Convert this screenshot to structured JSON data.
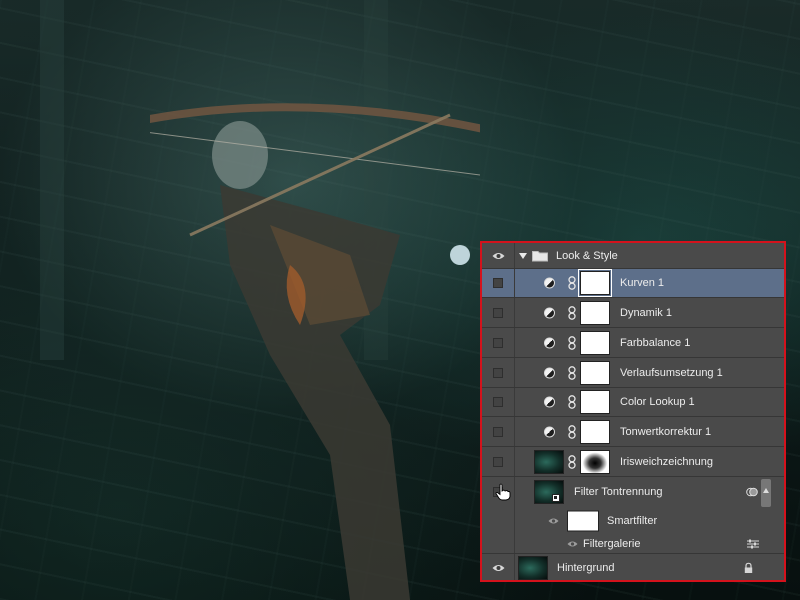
{
  "layers_panel": {
    "group": {
      "name": "Look & Style",
      "expanded": true,
      "visible": true
    },
    "layers": [
      {
        "name": "Kurven 1",
        "visible": false,
        "selected": true
      },
      {
        "name": "Dynamik 1",
        "visible": false,
        "selected": false
      },
      {
        "name": "Farbbalance 1",
        "visible": false,
        "selected": false
      },
      {
        "name": "Verlaufsumsetzung 1",
        "visible": false,
        "selected": false
      },
      {
        "name": "Color Lookup 1",
        "visible": false,
        "selected": false
      },
      {
        "name": "Tonwertkorrektur 1",
        "visible": false,
        "selected": false
      },
      {
        "name": "Irisweichzeichnung",
        "visible": false,
        "selected": false
      }
    ],
    "smart_object": {
      "name": "Filter Tontrennung",
      "visible": false,
      "smartfilter_label": "Smartfilter",
      "filter_name": "Filtergalerie"
    },
    "background_layer": {
      "name": "Hintergrund",
      "visible": true,
      "locked": true
    }
  },
  "colors": {
    "panel_bg": "#4a4a4a",
    "selected_row": "#5d6f8a",
    "highlight_border": "#d4121c",
    "scene_accent": "#2c6a5c"
  },
  "icons": {
    "visibility": "eye-icon",
    "adjustment": "adjustment-layer-icon",
    "link": "chain-link-icon",
    "folder": "folder-icon",
    "smart_object": "smart-object-icon",
    "filter_options": "filter-blending-options-icon",
    "lock": "lock-icon",
    "pointer": "hand-cursor-icon"
  }
}
